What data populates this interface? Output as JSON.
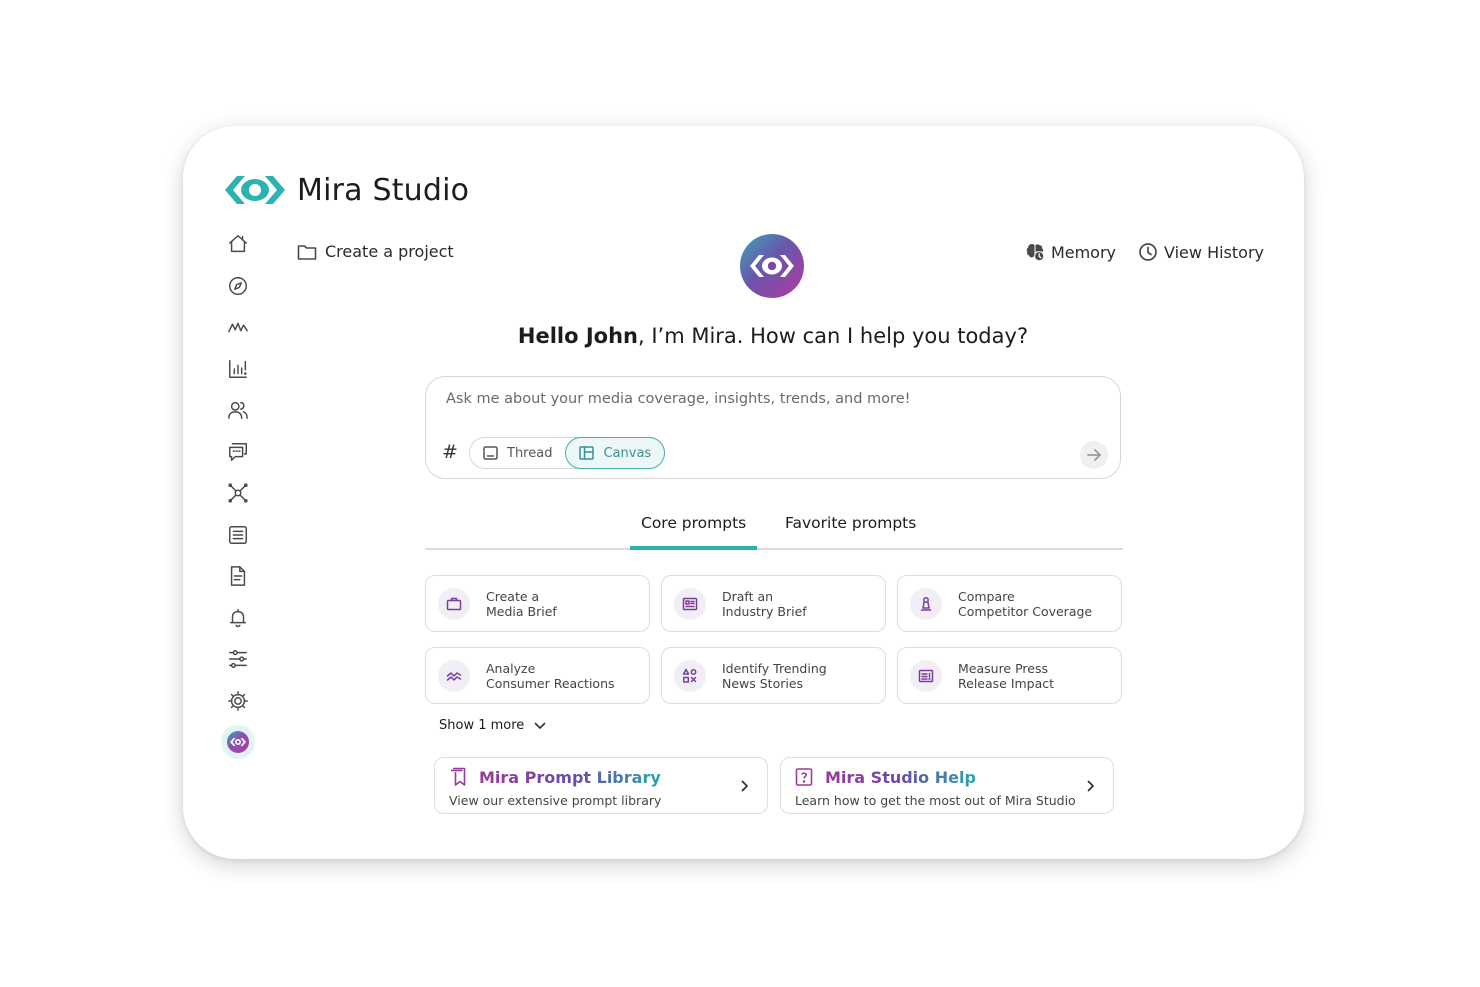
{
  "brand": {
    "name": "Mira Studio",
    "logo_icon": "mira-eye-logo"
  },
  "sidebar": {
    "items": [
      {
        "name": "home",
        "icon": "home-icon"
      },
      {
        "name": "explore",
        "icon": "compass-icon"
      },
      {
        "name": "trends",
        "icon": "activity-icon"
      },
      {
        "name": "analytics",
        "icon": "bar-chart-icon"
      },
      {
        "name": "audience",
        "icon": "users-icon"
      },
      {
        "name": "conversations",
        "icon": "chat-icon"
      },
      {
        "name": "network",
        "icon": "network-icon"
      },
      {
        "name": "newsfeed",
        "icon": "list-icon"
      },
      {
        "name": "reports",
        "icon": "document-icon"
      },
      {
        "name": "alerts",
        "icon": "bell-icon"
      },
      {
        "name": "filters",
        "icon": "sliders-icon"
      },
      {
        "name": "settings",
        "icon": "gear-icon"
      },
      {
        "name": "mira",
        "icon": "mira-eye-icon"
      }
    ]
  },
  "header": {
    "create_project": "Create a project",
    "memory": "Memory",
    "view_history": "View History"
  },
  "greeting": {
    "name": "Hello John",
    "rest": ", I’m Mira. How can I help you today?"
  },
  "chat": {
    "placeholder": "Ask me about your media coverage, insights, trends, and more!",
    "hash": "#",
    "modes": {
      "thread": "Thread",
      "canvas": "Canvas"
    },
    "selected_mode": "Canvas"
  },
  "tabs": {
    "core": "Core prompts",
    "favorite": "Favorite prompts",
    "active": "Core prompts"
  },
  "prompts": [
    {
      "line1": "Create a",
      "line2": "Media Brief",
      "icon": "briefcase-icon"
    },
    {
      "line1": "Draft an",
      "line2": "Industry Brief",
      "icon": "newspaper-icon"
    },
    {
      "line1": "Compare",
      "line2": "Competitor Coverage",
      "icon": "chess-pawn-icon"
    },
    {
      "line1": "Analyze",
      "line2": "Consumer Reactions",
      "icon": "trend-lines-icon"
    },
    {
      "line1": "Identify Trending",
      "line2": "News Stories",
      "icon": "shapes-icon"
    },
    {
      "line1": "Measure Press",
      "line2": "Release Impact",
      "icon": "release-icon"
    }
  ],
  "show_more": "Show 1 more",
  "resources": [
    {
      "title": "Mira Prompt Library",
      "subtitle": "View our extensive prompt library",
      "icon": "bookmark-icon"
    },
    {
      "title": "Mira Studio Help",
      "subtitle": "Learn how to get the most out of Mira Studio",
      "icon": "help-icon"
    }
  ],
  "colors": {
    "teal": "#2cb0b0",
    "purple": "#9b3a9d",
    "border": "#dedede"
  }
}
